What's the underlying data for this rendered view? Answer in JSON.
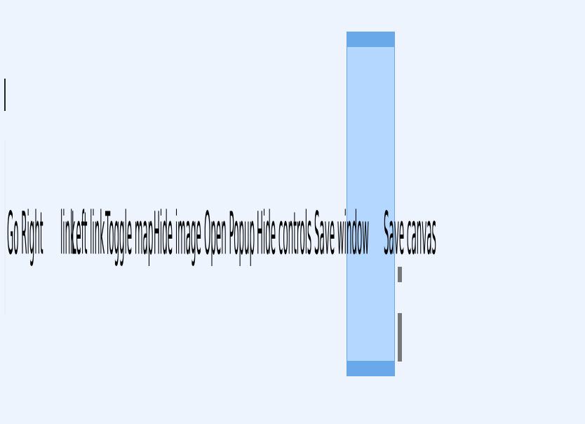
{
  "toolbar": {
    "buttons": [
      "Go Right",
      "link",
      "Left link",
      "Toggle map",
      "Hide image",
      "Open Popup",
      "Hide controls",
      "Save window",
      "Save canvas"
    ]
  },
  "colors": {
    "background": "#eef4fd",
    "selection_fill": "#b3d7fe",
    "selection_accent": "#6aa9e9",
    "scroll_handle": "#777777"
  }
}
